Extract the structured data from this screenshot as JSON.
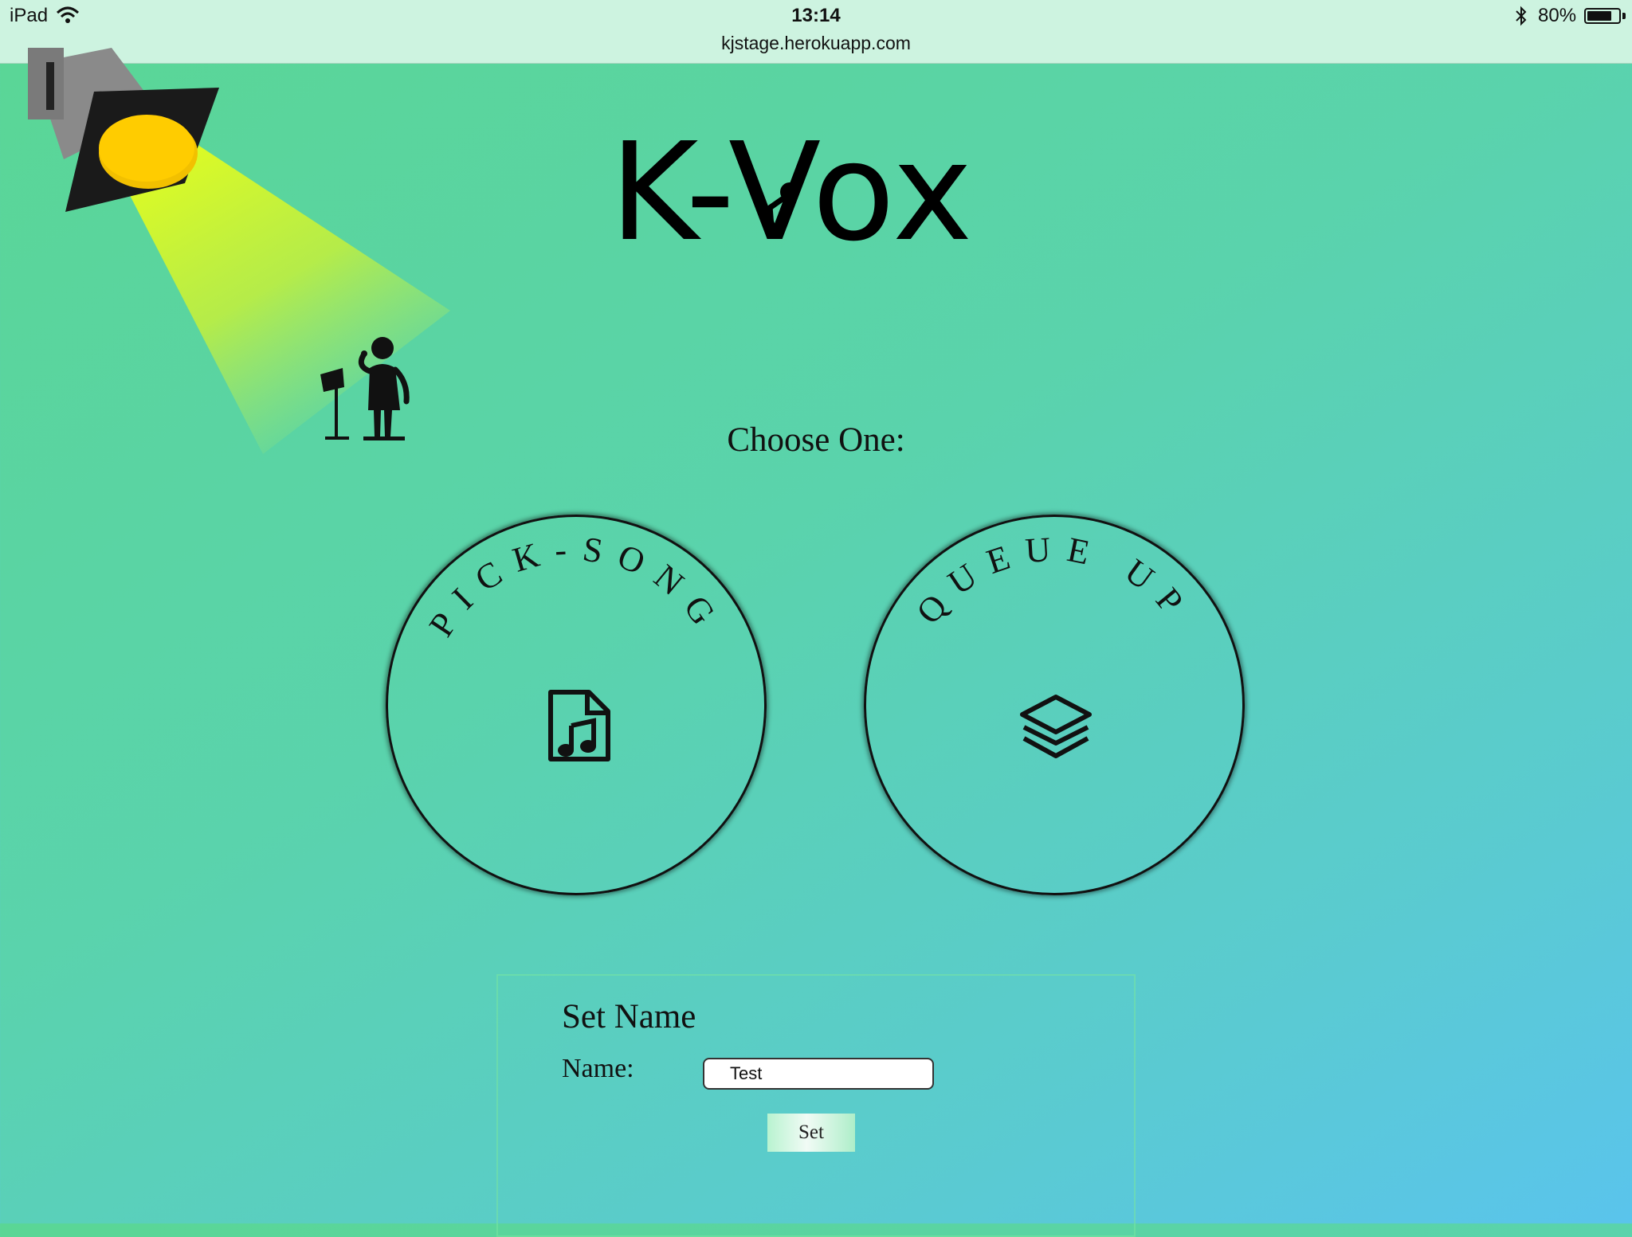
{
  "status_bar": {
    "device": "iPad",
    "time": "13:14",
    "url": "kjstage.herokuapp.com",
    "battery_percent": "80%",
    "battery_level": 0.8,
    "icons": [
      "wifi-icon",
      "bluetooth-icon",
      "battery-icon"
    ]
  },
  "header": {
    "logo_text": "K-Vox",
    "decorations": [
      "spotlight-icon",
      "singer-icon",
      "microphone-icon"
    ]
  },
  "main": {
    "prompt": "Choose One:",
    "options": [
      {
        "label": "PICK-SONG",
        "icon": "music-file-icon"
      },
      {
        "label": "QUEUE UP",
        "icon": "layers-icon"
      }
    ]
  },
  "set_name": {
    "title": "Set Name",
    "name_label": "Name:",
    "name_value": "Test",
    "button_label": "Set"
  },
  "colors": {
    "background_start": "#5ad695",
    "background_end": "#5ac4ec",
    "spot_bulb": "#ffc800",
    "spot_beam": "#d8f82a"
  }
}
